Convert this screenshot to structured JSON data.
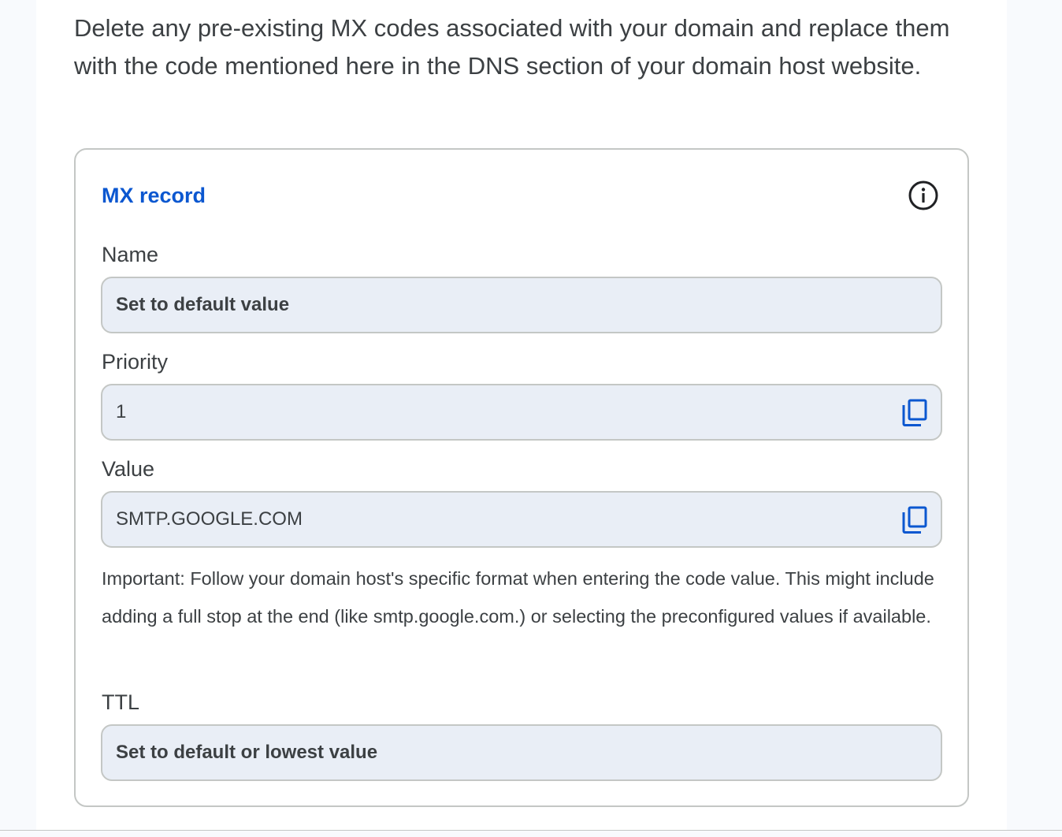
{
  "instructions": {
    "text": "Delete any pre-existing MX codes associated with your domain and replace them with the code mentioned here in the DNS section of your domain host website."
  },
  "mx_card": {
    "title": "MX record",
    "info_icon": "info-icon",
    "fields": [
      {
        "label": "Name",
        "value": "Set to default value",
        "copyable": false
      },
      {
        "label": "Priority",
        "value": "1",
        "copyable": true
      },
      {
        "label": "Value",
        "value": "SMTP.GOOGLE.COM",
        "copyable": true
      },
      {
        "label": "TTL",
        "value": "Set to default or lowest value",
        "copyable": false
      }
    ],
    "important_note": "Important: Follow your domain host's specific format when entering the code value. This might include adding a full stop at the end (like smtp.google.com.) or selecting the preconfigured values if available.",
    "copy_icon": "copy-icon"
  },
  "colors": {
    "accent": "#0b57d0",
    "text": "#3c4043",
    "field_bg": "#e9eef6",
    "border": "#c4c7c5",
    "page_bg": "#f8fafd"
  }
}
